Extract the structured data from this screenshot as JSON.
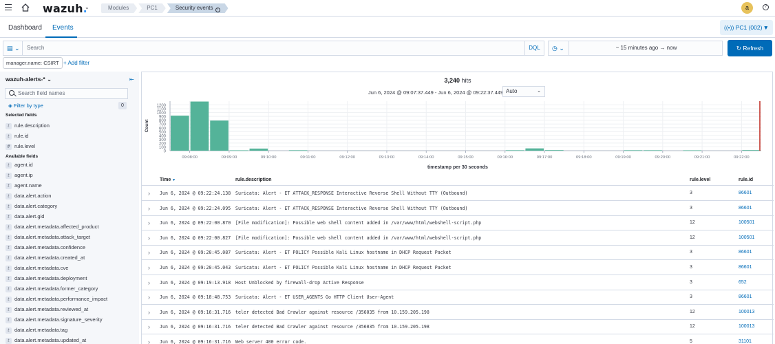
{
  "nav": {
    "logo_text": "wazuh",
    "breadcrumbs": [
      "Modules",
      "PC1",
      "Security events"
    ],
    "avatar_letter": "a"
  },
  "tabs": [
    {
      "label": "Dashboard",
      "selected": false
    },
    {
      "label": "Events",
      "selected": true
    }
  ],
  "agent_button": "PC1 (002)",
  "search": {
    "placeholder": "Search",
    "language": "DQL"
  },
  "time": {
    "range": "~ 15 minutes ago  →  now",
    "refresh_label": "Refresh"
  },
  "filters": {
    "pill": "manager.name: CSIRT",
    "add_label": "+ Add filter"
  },
  "sidebar": {
    "index_pattern": "wazuh-alerts-*",
    "search_placeholder": "Search field names",
    "filter_by_type": "Filter by type",
    "filter_count": "0",
    "selected_title": "Selected fields",
    "selected_fields": [
      "rule.description",
      "rule.id",
      "rule.level"
    ],
    "available_title": "Available fields",
    "available_fields": [
      "agent.id",
      "agent.ip",
      "agent.name",
      "data.alert.action",
      "data.alert.category",
      "data.alert.gid",
      "data.alert.metadata.affected_product",
      "data.alert.metadata.attack_target",
      "data.alert.metadata.confidence",
      "data.alert.metadata.created_at",
      "data.alert.metadata.cve",
      "data.alert.metadata.deployment",
      "data.alert.metadata.former_category",
      "data.alert.metadata.performance_impact",
      "data.alert.metadata.reviewed_at",
      "data.alert.metadata.signature_severity",
      "data.alert.metadata.tag",
      "data.alert.metadata.updated_at"
    ]
  },
  "hits": {
    "count": "3,240",
    "label": "hits",
    "range": "Jun 6, 2024 @ 09:07:37.449 - Jun 6, 2024 @ 09:22:37.449",
    "interval": "Auto"
  },
  "chart_data": {
    "type": "bar",
    "title": "",
    "xlabel": "timestamp per 30 seconds",
    "ylabel": "Count",
    "ylim": [
      0,
      1300
    ],
    "yticks": [
      0,
      100,
      200,
      300,
      400,
      500,
      600,
      700,
      800,
      900,
      1000,
      1100,
      1200
    ],
    "xticks": [
      "09:08:00",
      "09:09:00",
      "09:10:00",
      "09:11:00",
      "09:12:00",
      "09:13:00",
      "09:14:00",
      "09:15:00",
      "09:16:00",
      "09:17:00",
      "09:18:00",
      "09:19:00",
      "09:20:00",
      "09:21:00",
      "09:22:00"
    ],
    "x": [
      "09:07:30",
      "09:08:00",
      "09:08:30",
      "09:09:00",
      "09:09:30",
      "09:10:00",
      "09:10:30",
      "09:11:00",
      "09:11:30",
      "09:12:00",
      "09:12:30",
      "09:13:00",
      "09:13:30",
      "09:14:00",
      "09:14:30",
      "09:15:00",
      "09:15:30",
      "09:16:00",
      "09:16:30",
      "09:17:00",
      "09:17:30",
      "09:18:00",
      "09:18:30",
      "09:19:00",
      "09:19:30",
      "09:20:00",
      "09:20:30",
      "09:21:00",
      "09:21:30",
      "09:22:00"
    ],
    "values": [
      920,
      1290,
      790,
      10,
      55,
      0,
      12,
      0,
      0,
      0,
      0,
      0,
      0,
      0,
      0,
      0,
      0,
      12,
      60,
      15,
      0,
      0,
      0,
      12,
      12,
      0,
      10,
      0,
      0,
      15
    ],
    "bar_color": "#54b399",
    "marker_color": "#bd271e",
    "grid": true
  },
  "table": {
    "headers": [
      "Time",
      "rule.description",
      "rule.level",
      "rule.id"
    ],
    "rows": [
      {
        "time": "Jun 6, 2024 @ 09:22:24.138",
        "desc": "Suricata: Alert - ET ATTACK_RESPONSE Interactive Reverse Shell Without TTY (Outbound)",
        "level": "3",
        "id": "86601"
      },
      {
        "time": "Jun 6, 2024 @ 09:22:24.095",
        "desc": "Suricata: Alert - ET ATTACK_RESPONSE Interactive Reverse Shell Without TTY (Outbound)",
        "level": "3",
        "id": "86601"
      },
      {
        "time": "Jun 6, 2024 @ 09:22:00.870",
        "desc": "[File modification]: Possible web shell content added in /var/www/html/webshell-script.php",
        "level": "12",
        "id": "100501"
      },
      {
        "time": "Jun 6, 2024 @ 09:22:00.827",
        "desc": "[File modification]: Possible web shell content added in /var/www/html/webshell-script.php",
        "level": "12",
        "id": "100501"
      },
      {
        "time": "Jun 6, 2024 @ 09:20:45.087",
        "desc": "Suricata: Alert - ET POLICY Possible Kali Linux hostname in DHCP Request Packet",
        "level": "3",
        "id": "86601"
      },
      {
        "time": "Jun 6, 2024 @ 09:20:45.043",
        "desc": "Suricata: Alert - ET POLICY Possible Kali Linux hostname in DHCP Request Packet",
        "level": "3",
        "id": "86601"
      },
      {
        "time": "Jun 6, 2024 @ 09:19:13.918",
        "desc": "Host Unblocked by firewall-drop Active Response",
        "level": "3",
        "id": "652"
      },
      {
        "time": "Jun 6, 2024 @ 09:18:48.753",
        "desc": "Suricata: Alert - ET USER_AGENTS Go HTTP Client User-Agent",
        "level": "3",
        "id": "86601"
      },
      {
        "time": "Jun 6, 2024 @ 09:16:31.716",
        "desc": "teler detected Bad Crawler against resource /356035 from 10.159.205.198",
        "level": "12",
        "id": "100013"
      },
      {
        "time": "Jun 6, 2024 @ 09:16:31.716",
        "desc": "teler detected Bad Crawler against resource /356035 from 10.159.205.198",
        "level": "12",
        "id": "100013"
      },
      {
        "time": "Jun 6, 2024 @ 09:16:31.716",
        "desc": "Web server 400 error code.",
        "level": "5",
        "id": "31101"
      }
    ]
  }
}
